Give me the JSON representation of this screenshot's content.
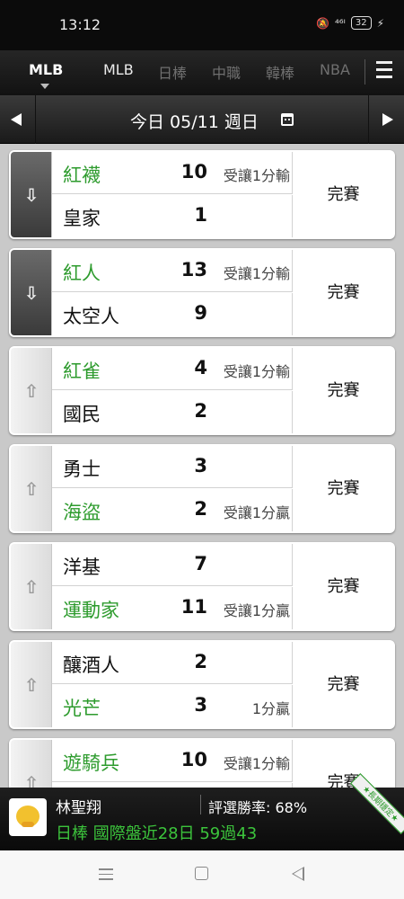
{
  "status_bar": {
    "time": "13:12",
    "signal": "⁴⁶ᴵ",
    "battery": "32"
  },
  "tabs": {
    "items": [
      {
        "label": "MLB",
        "state": "active"
      },
      {
        "label": "MLB",
        "state": "on"
      },
      {
        "label": "日棒",
        "state": "off"
      },
      {
        "label": "中職",
        "state": "off"
      },
      {
        "label": "韓棒",
        "state": "off"
      },
      {
        "label": "NBA",
        "state": "off"
      }
    ]
  },
  "date_bar": {
    "label": "今日 05/11 週日"
  },
  "games": [
    {
      "side": "dark",
      "arrow": "down",
      "top_team": "紅襪",
      "top_score": "10",
      "top_note": "受讓1分輸",
      "top_win": true,
      "bot_team": "皇家",
      "bot_score": "1",
      "bot_note": "",
      "bot_win": false,
      "status": "完賽"
    },
    {
      "side": "dark",
      "arrow": "down",
      "top_team": "紅人",
      "top_score": "13",
      "top_note": "受讓1分輸",
      "top_win": true,
      "bot_team": "太空人",
      "bot_score": "9",
      "bot_note": "",
      "bot_win": false,
      "status": "完賽"
    },
    {
      "side": "light",
      "arrow": "up",
      "top_team": "紅雀",
      "top_score": "4",
      "top_note": "受讓1分輸",
      "top_win": true,
      "bot_team": "國民",
      "bot_score": "2",
      "bot_note": "",
      "bot_win": false,
      "status": "完賽"
    },
    {
      "side": "light",
      "arrow": "up",
      "top_team": "勇士",
      "top_score": "3",
      "top_note": "",
      "top_win": false,
      "bot_team": "海盜",
      "bot_score": "2",
      "bot_note": "受讓1分贏",
      "bot_win": true,
      "status": "完賽"
    },
    {
      "side": "light",
      "arrow": "up",
      "top_team": "洋基",
      "top_score": "7",
      "top_note": "",
      "top_win": false,
      "bot_team": "運動家",
      "bot_score": "11",
      "bot_note": "受讓1分贏",
      "bot_win": true,
      "status": "完賽"
    },
    {
      "side": "light",
      "arrow": "up",
      "top_team": "釀酒人",
      "top_score": "2",
      "top_note": "",
      "top_win": false,
      "bot_team": "光芒",
      "bot_score": "3",
      "bot_note": "1分贏",
      "bot_win": true,
      "status": "完賽"
    },
    {
      "side": "light",
      "arrow": "up",
      "top_team": "遊騎兵",
      "top_score": "10",
      "top_note": "受讓1分輸",
      "top_win": true,
      "bot_team": "",
      "bot_score": "",
      "bot_note": "",
      "bot_win": false,
      "status": "完賽"
    }
  ],
  "expert": {
    "name": "林聖翔",
    "rate": "評選勝率: 68%",
    "record": "日棒 國際盤近28日 59過43",
    "ribbon": "★長期穩定★"
  },
  "colors": {
    "win_green": "#2d9b2d",
    "record_green": "#3cc43c"
  }
}
